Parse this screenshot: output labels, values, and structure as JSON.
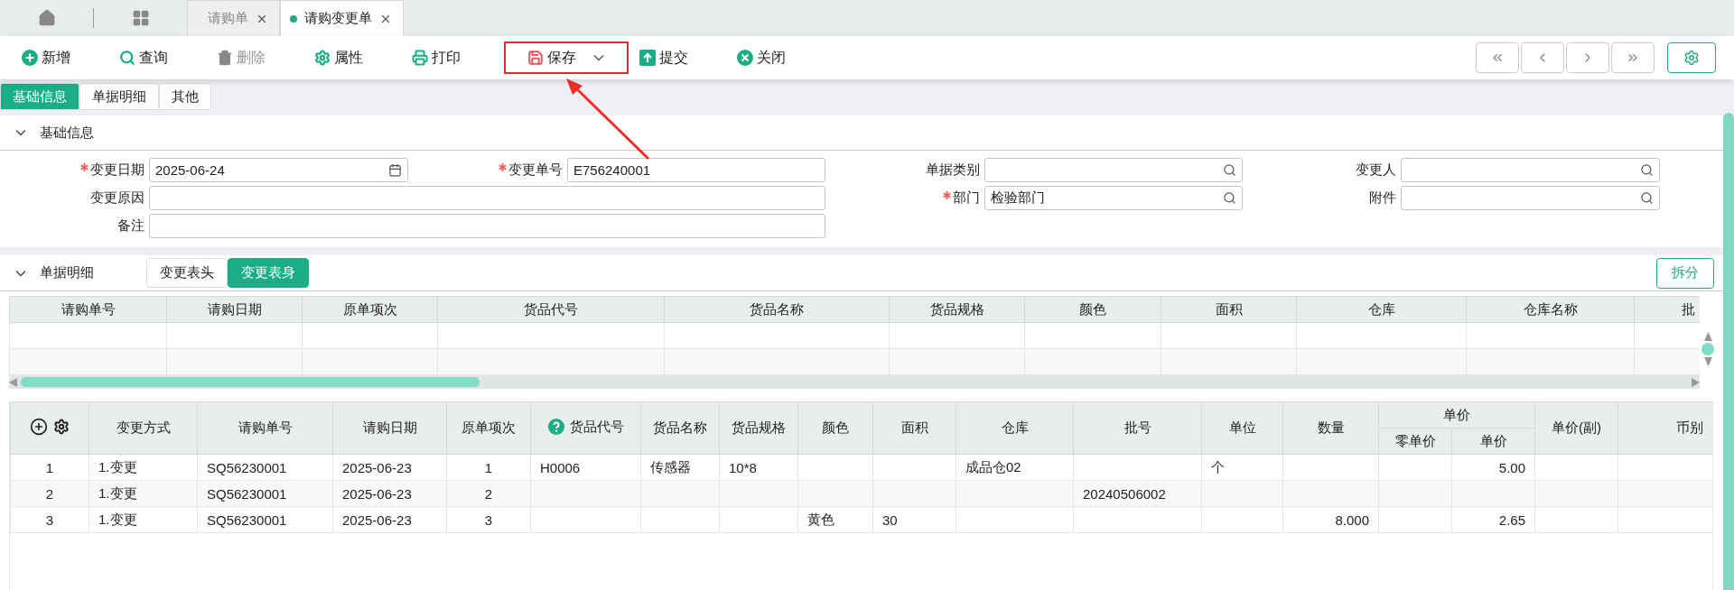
{
  "top_tabs": [
    {
      "label": "请购单",
      "selected": false
    },
    {
      "label": "请购变更单",
      "selected": true
    }
  ],
  "toolbar": [
    {
      "label": "新增",
      "kind": "add",
      "disabled": false,
      "highlighted": false,
      "dropdown": false
    },
    {
      "label": "查询",
      "kind": "search",
      "disabled": false,
      "highlighted": false,
      "dropdown": false
    },
    {
      "label": "删除",
      "kind": "delete",
      "disabled": true,
      "highlighted": false,
      "dropdown": false
    },
    {
      "label": "属性",
      "kind": "properties",
      "disabled": false,
      "highlighted": false,
      "dropdown": false
    },
    {
      "label": "打印",
      "kind": "print",
      "disabled": false,
      "highlighted": false,
      "dropdown": false
    },
    {
      "label": "保存",
      "kind": "save",
      "disabled": false,
      "highlighted": true,
      "dropdown": true
    },
    {
      "label": "提交",
      "kind": "submit",
      "disabled": false,
      "highlighted": false,
      "dropdown": false
    },
    {
      "label": "关闭",
      "kind": "close",
      "disabled": false,
      "highlighted": false,
      "dropdown": false
    }
  ],
  "section_tabs": [
    {
      "label": "基础信息",
      "selected": true
    },
    {
      "label": "单据明细",
      "selected": false
    },
    {
      "label": "其他",
      "selected": false
    }
  ],
  "basic_info": {
    "title": "基础信息",
    "expanded": true,
    "fields": [
      {
        "label": "变更日期",
        "required": true,
        "kind": "date",
        "value": "2025-06-24"
      },
      {
        "label": "变更单号",
        "required": true,
        "kind": "text",
        "value": "E756240001"
      },
      {
        "label": "单据类别",
        "required": false,
        "kind": "lookup"
      },
      {
        "label": "变更人",
        "required": false,
        "kind": "lookup"
      },
      {
        "label": "变更原因",
        "required": false,
        "kind": "wide"
      },
      {
        "label": "部门",
        "required": true,
        "kind": "lookup",
        "value": "检验部门"
      },
      {
        "label": "附件",
        "required": false,
        "kind": "lookup"
      },
      {
        "label": "备注",
        "required": false,
        "kind": "wide"
      }
    ]
  },
  "detail": {
    "title": "单据明细",
    "expanded": true,
    "sub_tabs": [
      {
        "label": "变更表头",
        "selected": false
      },
      {
        "label": "变更表身",
        "selected": true
      }
    ],
    "split_button": "拆分",
    "header_grid": {
      "columns": [
        "请购单号",
        "请购日期",
        "原单项次",
        "货品代号",
        "货品名称",
        "货品规格",
        "颜色",
        "面积",
        "仓库",
        "仓库名称",
        "批"
      ]
    },
    "body_grid": {
      "columns": [
        {
          "kind": "actions"
        },
        {
          "kind": "text",
          "label": "变更方式"
        },
        {
          "kind": "text",
          "label": "请购单号"
        },
        {
          "kind": "text",
          "label": "请购日期"
        },
        {
          "kind": "text",
          "label": "原单项次"
        },
        {
          "kind": "help",
          "label": "货品代号"
        },
        {
          "kind": "text",
          "label": "货品名称"
        },
        {
          "kind": "text",
          "label": "货品规格"
        },
        {
          "kind": "text",
          "label": "颜色"
        },
        {
          "kind": "text",
          "label": "面积"
        },
        {
          "kind": "text",
          "label": "仓库"
        },
        {
          "kind": "text",
          "label": "批号"
        },
        {
          "kind": "text",
          "label": "单位"
        },
        {
          "kind": "text",
          "label": "数量"
        },
        {
          "kind": "group",
          "label": "单价",
          "colspan": 2,
          "children": [
            "零单价",
            "单价"
          ]
        },
        {
          "kind": "text",
          "label": "单价(副)"
        },
        {
          "kind": "text",
          "label": "币别"
        }
      ],
      "rows": [
        [
          "1",
          "1.变更",
          "SQ56230001",
          "2025-06-23",
          "1",
          "H0006",
          "传感器",
          "10*8",
          null,
          null,
          "成品仓02",
          null,
          "个",
          null,
          null,
          "5.00",
          null,
          null
        ],
        [
          "2",
          "1.变更",
          "SQ56230001",
          "2025-06-23",
          "2",
          null,
          null,
          null,
          null,
          null,
          null,
          "20240506002",
          null,
          null,
          null,
          null,
          null,
          null
        ],
        [
          "3",
          "1.变更",
          "SQ56230001",
          "2025-06-23",
          "3",
          null,
          null,
          null,
          "黄色",
          "30",
          null,
          null,
          null,
          "8.000",
          null,
          "2.65",
          null,
          null
        ]
      ]
    }
  }
}
